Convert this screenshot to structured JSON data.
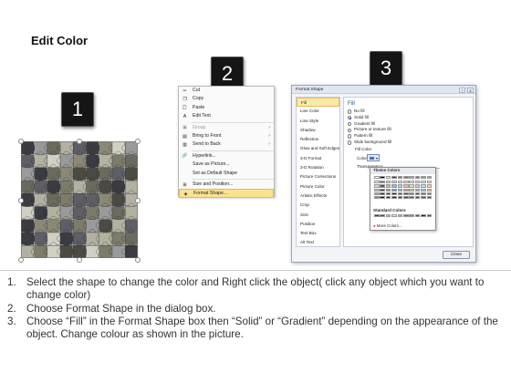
{
  "title": "Edit Color",
  "step_badges": [
    "1",
    "2",
    "3"
  ],
  "context_menu": {
    "items": [
      {
        "icon": "cut-icon",
        "glyph": "✂",
        "label": "Cut",
        "disabled": false
      },
      {
        "icon": "copy-icon",
        "glyph": "❐",
        "label": "Copy",
        "disabled": false
      },
      {
        "icon": "paste-icon",
        "glyph": "📋",
        "label": "Paste",
        "disabled": false
      },
      {
        "icon": "edit-text-icon",
        "glyph": "A",
        "label": "Edit Text",
        "disabled": false
      },
      {
        "icon": "group-icon",
        "glyph": "▣",
        "label": "Group",
        "disabled": true,
        "arrow": "›"
      },
      {
        "icon": "bring-to-front-icon",
        "glyph": "▤",
        "label": "Bring to Front",
        "disabled": false,
        "arrow": "›"
      },
      {
        "icon": "send-to-back-icon",
        "glyph": "▥",
        "label": "Send to Back",
        "disabled": false,
        "arrow": "›"
      },
      {
        "icon": "hyperlink-icon",
        "glyph": "🔗",
        "label": "Hyperlink...",
        "disabled": false
      },
      {
        "icon": "save-as-picture-icon",
        "glyph": "",
        "label": "Save as Picture...",
        "disabled": false
      },
      {
        "icon": "default-shape-icon",
        "glyph": "",
        "label": "Set as Default Shape",
        "disabled": false
      },
      {
        "icon": "size-position-icon",
        "glyph": "⊞",
        "label": "Size and Position...",
        "disabled": false
      },
      {
        "icon": "format-shape-icon",
        "glyph": "◈",
        "label": "Format Shape...",
        "disabled": false,
        "highlighted": true
      }
    ]
  },
  "dialog": {
    "title": "Format Shape",
    "window_buttons": [
      "?",
      "✕"
    ],
    "sidebar": [
      "Fill",
      "Line Color",
      "Line Style",
      "Shadow",
      "Reflection",
      "Glow and Soft Edges",
      "3-D Format",
      "3-D Rotation",
      "Picture Corrections",
      "Picture Color",
      "Artistic Effects",
      "Crop",
      "Size",
      "Position",
      "Text Box",
      "Alt Text"
    ],
    "section_title": "Fill",
    "fill_options": [
      {
        "label": "No fill",
        "checked": false
      },
      {
        "label": "Solid fill",
        "checked": true
      },
      {
        "label": "Gradient fill",
        "checked": false
      },
      {
        "label": "Picture or texture fill",
        "checked": false
      },
      {
        "label": "Pattern fill",
        "checked": false
      },
      {
        "label": "Slide background fill",
        "checked": false
      }
    ],
    "fill_color_label": "Fill Color",
    "color_label": "Color:",
    "transparency_label": "Transparency:",
    "close_label": "Close"
  },
  "palette": {
    "theme_header": "Theme Colors",
    "standard_header": "Standard Colors",
    "more_colors": "More Colors...",
    "theme_columns": [
      [
        "#ffffff",
        "#f2f2f2",
        "#d9d9d9",
        "#bfbfbf",
        "#a6a6a6",
        "#7f7f7f"
      ],
      [
        "#000000",
        "#7f7f7f",
        "#595959",
        "#404040",
        "#262626",
        "#0d0d0d"
      ],
      [
        "#eeece1",
        "#ddd9c3",
        "#c4bd97",
        "#948a54",
        "#4a452a",
        "#1d1b10"
      ],
      [
        "#1f497d",
        "#c6d9f0",
        "#8db3e2",
        "#548dd4",
        "#17365d",
        "#0f243e"
      ],
      [
        "#4f81bd",
        "#dbe5f1",
        "#b8cce4",
        "#95b3d7",
        "#366092",
        "#244061"
      ],
      [
        "#c0504d",
        "#f2dcdb",
        "#e5b9b7",
        "#d99694",
        "#953734",
        "#632423"
      ],
      [
        "#9bbb59",
        "#ebf1dd",
        "#d7e3bc",
        "#c3d69b",
        "#76923c",
        "#4f6128"
      ],
      [
        "#8064a2",
        "#e5e0ec",
        "#ccc1d9",
        "#b2a2c7",
        "#5f497a",
        "#3f3151"
      ],
      [
        "#4bacc6",
        "#dbeef3",
        "#b7dde8",
        "#92cddc",
        "#31859b",
        "#205867"
      ],
      [
        "#f79646",
        "#fdeada",
        "#fbd5b5",
        "#fac08f",
        "#e36c09",
        "#974806"
      ]
    ],
    "standard_colors": [
      "#c00000",
      "#ff0000",
      "#ffc000",
      "#ffff00",
      "#92d050",
      "#00b050",
      "#00b0f0",
      "#0070c0",
      "#002060",
      "#7030a0"
    ]
  },
  "puzzle": {
    "colors": [
      "#8c8877",
      "#6b6a5e",
      "#b3b1a0",
      "#5e5f66",
      "#3b3c42",
      "#9a9a9a",
      "#7d7b69",
      "#d2d0c4",
      "#4c4b43"
    ]
  },
  "instructions": [
    {
      "num": "1.",
      "text": "Select the shape to change the color and Right click the object( click any object which you want to change color)"
    },
    {
      "num": "2.",
      "text": "Choose Format Shape in the dialog box."
    },
    {
      "num": "3.",
      "text": "Choose “Fill” in the Format Shape box then “Solid” or “Gradient” depending on the appearance of the object. Change colour as shown in the picture."
    }
  ]
}
